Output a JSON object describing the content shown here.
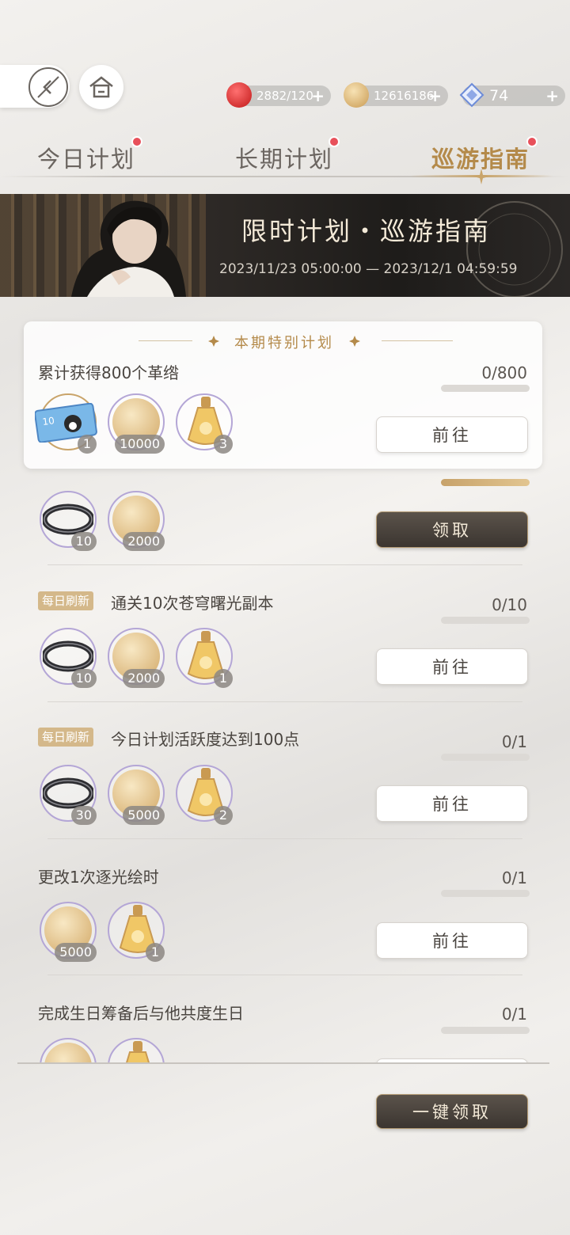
{
  "resources": [
    {
      "icon": "apple-icon",
      "value": "2882/120",
      "color": "#d12a2a"
    },
    {
      "icon": "coin-icon",
      "value": "12616186",
      "color": "#d9b26a"
    },
    {
      "icon": "crystal-icon",
      "value": "74",
      "color": "#6d8cd8"
    }
  ],
  "plus": "+",
  "tabs": [
    {
      "label": "今日计划",
      "active": false,
      "badge": true
    },
    {
      "label": "长期计划",
      "active": false,
      "badge": true
    },
    {
      "label": "巡游指南",
      "active": true,
      "badge": true
    }
  ],
  "banner": {
    "title": "限时计划・巡游指南",
    "date_range": "2023/11/23 05:00:00 — 2023/12/1 04:59:59"
  },
  "special": {
    "header": "本期特别计划",
    "task": "累计获得800个革绺",
    "count": "0/800",
    "rewards": [
      {
        "icon": "ticket-icon",
        "qty": "1"
      },
      {
        "icon": "coin-icon",
        "qty": "10000"
      },
      {
        "icon": "potion-icon",
        "qty": "3"
      }
    ],
    "button": "前往"
  },
  "tasks": [
    {
      "tag": "",
      "title": "",
      "count": "",
      "progress": 1,
      "rewards": [
        {
          "icon": "ring-icon",
          "qty": "10"
        },
        {
          "icon": "coin-icon",
          "qty": "2000"
        }
      ],
      "button": "领取",
      "claimable": true
    },
    {
      "tag": "每日刷新",
      "title": "通关10次苍穹曙光副本",
      "count": "0/10",
      "progress": 0,
      "rewards": [
        {
          "icon": "ring-icon",
          "qty": "10"
        },
        {
          "icon": "coin-icon",
          "qty": "2000"
        },
        {
          "icon": "potion-icon",
          "qty": "1"
        }
      ],
      "button": "前往",
      "claimable": false
    },
    {
      "tag": "每日刷新",
      "title": "今日计划活跃度达到100点",
      "count": "0/1",
      "progress": 0,
      "rewards": [
        {
          "icon": "ring-icon",
          "qty": "30"
        },
        {
          "icon": "coin-icon",
          "qty": "5000"
        },
        {
          "icon": "potion-icon",
          "qty": "2"
        }
      ],
      "button": "前往",
      "claimable": false
    },
    {
      "tag": "",
      "title": "更改1次逐光绘时",
      "count": "0/1",
      "progress": 0,
      "rewards": [
        {
          "icon": "coin-icon",
          "qty": "5000"
        },
        {
          "icon": "potion-icon",
          "qty": "1"
        }
      ],
      "button": "前往",
      "claimable": false
    },
    {
      "tag": "",
      "title": "完成生日筹备后与他共度生日",
      "count": "0/1",
      "progress": 0,
      "rewards": [
        {
          "icon": "coin-icon",
          "qty": ""
        },
        {
          "icon": "potion-icon",
          "qty": ""
        }
      ],
      "button": "",
      "claimable": false
    }
  ],
  "claim_all": "一键领取",
  "colors": {
    "accent": "#b48a4a",
    "badge": "#e8505a",
    "dark_button": "#3b3530"
  }
}
